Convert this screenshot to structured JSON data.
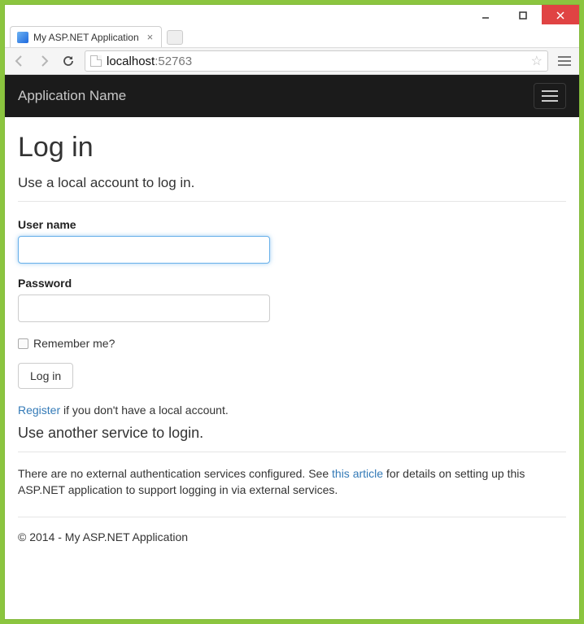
{
  "window": {
    "tab_title": "My ASP.NET Application",
    "url_host": "localhost",
    "url_port": ":52763"
  },
  "navbar": {
    "brand": "Application Name"
  },
  "login": {
    "heading": "Log in",
    "subheading": "Use a local account to log in.",
    "username_label": "User name",
    "username_value": "",
    "password_label": "Password",
    "password_value": "",
    "remember_label": "Remember me?",
    "submit_label": "Log in",
    "register_link": "Register",
    "register_rest": " if you don't have a local account."
  },
  "external": {
    "heading": "Use another service to login.",
    "text_before": "There are no external authentication services configured. See ",
    "link_text": "this article",
    "text_after": " for details on setting up this ASP.NET application to support logging in via external services."
  },
  "footer": {
    "text": "© 2014 - My ASP.NET Application"
  }
}
